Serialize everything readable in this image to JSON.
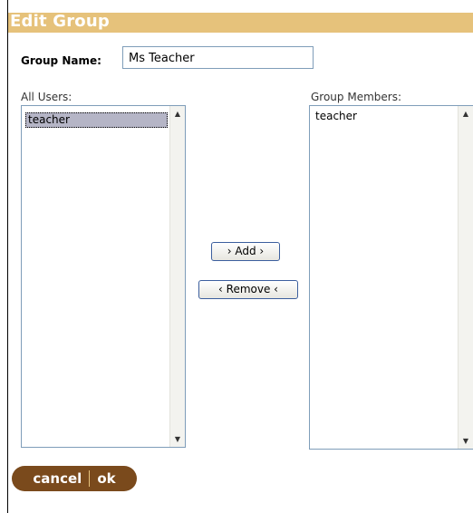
{
  "dialog": {
    "title": "Edit Group"
  },
  "group_name": {
    "label": "Group Name:",
    "value": "Ms Teacher"
  },
  "all_users": {
    "label": "All Users:",
    "items": [
      {
        "label": "teacher",
        "selected": true
      }
    ]
  },
  "group_members": {
    "label": "Group Members:",
    "items": [
      {
        "label": "teacher",
        "selected": false
      }
    ]
  },
  "buttons": {
    "add": "› Add ›",
    "remove": "‹ Remove ‹"
  },
  "footer": {
    "cancel": "cancel",
    "ok": "ok"
  },
  "colors": {
    "title_bar": "#e6c27b",
    "footer_pill": "#7a4a1c",
    "selection": "#b5b5c6"
  }
}
